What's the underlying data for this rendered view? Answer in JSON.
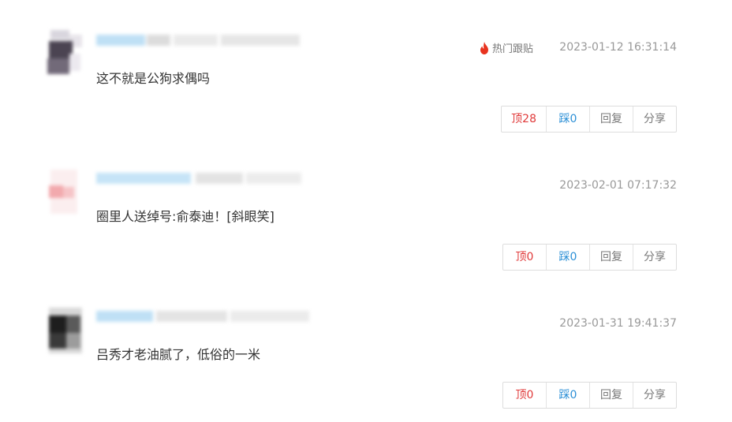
{
  "comments": [
    {
      "text": "这不就是公狗求偶吗",
      "timestamp": "2023-01-12 16:31:14",
      "hot_label": "热门跟贴",
      "up_label": "顶28",
      "down_label": "踩0",
      "reply_label": "回复",
      "share_label": "分享"
    },
    {
      "text": "圈里人送绰号:俞泰迪！[斜眼笑]",
      "timestamp": "2023-02-01 07:17:32",
      "up_label": "顶0",
      "down_label": "踩0",
      "reply_label": "回复",
      "share_label": "分享"
    },
    {
      "text": "吕秀才老油腻了，低俗的一米",
      "timestamp": "2023-01-31 19:41:37",
      "up_label": "顶0",
      "down_label": "踩0",
      "reply_label": "回复",
      "share_label": "分享"
    }
  ],
  "colors": {
    "up": "#e03a3a",
    "down": "#2b8fd6",
    "meta": "#999999",
    "hot_icon": "#e8331f"
  },
  "icons": {
    "hot": "flame-icon"
  }
}
